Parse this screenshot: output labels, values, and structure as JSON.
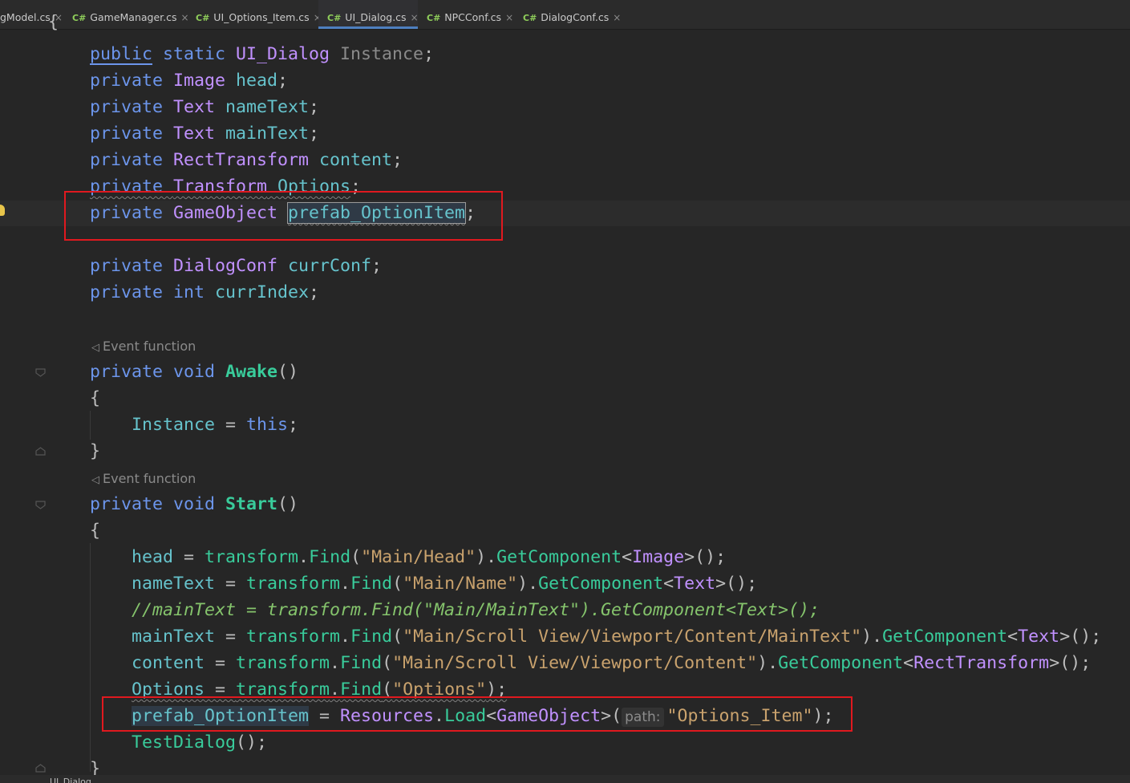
{
  "tabs": [
    {
      "label": "gModel.cs",
      "icon": "",
      "active": false
    },
    {
      "label": "GameManager.cs",
      "icon": "C#",
      "active": false
    },
    {
      "label": "UI_Options_Item.cs",
      "icon": "C#",
      "active": false
    },
    {
      "label": "UI_Dialog.cs",
      "icon": "C#",
      "active": true
    },
    {
      "label": "NPCConf.cs",
      "icon": "C#",
      "active": false
    },
    {
      "label": "DialogConf.cs",
      "icon": "C#",
      "active": false
    }
  ],
  "tab_close": "×",
  "inlays": {
    "event_function_1": "Event function",
    "event_function_2": "Event function",
    "event_icon": "◁"
  },
  "param_hint": "path:",
  "breadcrumb": "UI_Dialog",
  "colors": {
    "keyword": "#6c95eb",
    "type": "#c191ff",
    "field": "#66c3cc",
    "string": "#c9a26d",
    "method": "#39cc9b",
    "comment": "#85c46c",
    "highlight_box": "#e0191f",
    "active_tab_underline": "#4e7fc0"
  },
  "code": {
    "l0": "{",
    "l1": {
      "a": "public",
      "b": " static ",
      "c": "UI_Dialog",
      "d": " Instance",
      "e": ";"
    },
    "l2": {
      "a": "private ",
      "b": "Image",
      "c": " head",
      "d": ";"
    },
    "l3": {
      "a": "private ",
      "b": "Text",
      "c": " nameText",
      "d": ";"
    },
    "l4": {
      "a": "private ",
      "b": "Text",
      "c": " mainText",
      "d": ";"
    },
    "l5": {
      "a": "private ",
      "b": "RectTransform",
      "c": " content",
      "d": ";"
    },
    "l6": {
      "a": "private ",
      "b": "Transform",
      "c": " Options",
      "d": ";"
    },
    "l7": {
      "a": "private ",
      "b": "GameObject",
      "c": " ",
      "d": "prefab_OptionItem",
      "e": ";"
    },
    "l8": {
      "a": "private ",
      "b": "DialogConf",
      "c": " currConf",
      "d": ";"
    },
    "l9": {
      "a": "private ",
      "b": "int",
      "c": " currIndex",
      "d": ";"
    },
    "l10": {
      "a": "private ",
      "b": "void ",
      "c": "Awake",
      "d": "()"
    },
    "l11": "{",
    "l12": {
      "a": "Instance",
      "b": " = ",
      "c": "this",
      "d": ";"
    },
    "l13": "}",
    "l14": {
      "a": "private ",
      "b": "void ",
      "c": "Start",
      "d": "()"
    },
    "l15": "{",
    "l16": {
      "a": "head",
      "b": " = ",
      "c": "transform",
      "d": ".",
      "e": "Find",
      "f": "(",
      "g": "\"Main/Head\"",
      "h": ").",
      "i": "GetComponent",
      "j": "<",
      "k": "Image",
      "l": ">();"
    },
    "l17": {
      "a": "nameText",
      "b": " = ",
      "c": "transform",
      "d": ".",
      "e": "Find",
      "f": "(",
      "g": "\"Main/Name\"",
      "h": ").",
      "i": "GetComponent",
      "j": "<",
      "k": "Text",
      "l": ">();"
    },
    "l18": "//mainText = transform.Find(\"Main/MainText\").GetComponent<Text>();",
    "l19": {
      "a": "mainText",
      "b": " = ",
      "c": "transform",
      "d": ".",
      "e": "Find",
      "f": "(",
      "g": "\"Main/Scroll View/Viewport/Content/MainText\"",
      "h": ").",
      "i": "GetComponent",
      "j": "<",
      "k": "Text",
      "l": ">();"
    },
    "l20": {
      "a": "content",
      "b": " = ",
      "c": "transform",
      "d": ".",
      "e": "Find",
      "f": "(",
      "g": "\"Main/Scroll View/Viewport/Content\"",
      "h": ").",
      "i": "GetComponent",
      "j": "<",
      "k": "RectTransform",
      "l": ">();"
    },
    "l21": {
      "a": "Options",
      "b": " = ",
      "c": "transform",
      "d": ".",
      "e": "Find",
      "f": "(",
      "g": "\"Options\"",
      "h": ");"
    },
    "l22": {
      "a": "prefab_OptionItem",
      "b": " = ",
      "c": "Resources",
      "d": ".",
      "e": "Load",
      "f": "<",
      "g": "GameObject",
      "h": ">(",
      "i": "\"Options_Item\"",
      "j": ");"
    },
    "l23": {
      "a": "TestDialog",
      "b": "();"
    },
    "l24": "}"
  }
}
